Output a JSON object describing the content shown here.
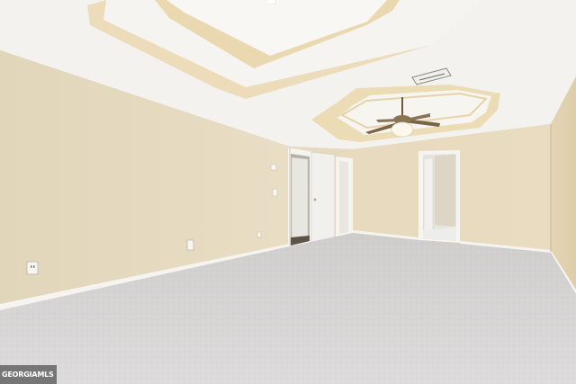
{
  "photo": {
    "subject": "empty-bedroom-with-tray-ceilings",
    "colors": {
      "wall": "#e7dcc2",
      "wall_shadow": "#d9ccaf",
      "ceiling": "#f4f2ee",
      "tray_trim": "#e9d8b4",
      "carpet": "#d8d6d6",
      "baseboard": "#f5f3ef",
      "door_white": "#f1f0ed"
    }
  },
  "watermark": {
    "text": "GEORGIAMLS"
  }
}
